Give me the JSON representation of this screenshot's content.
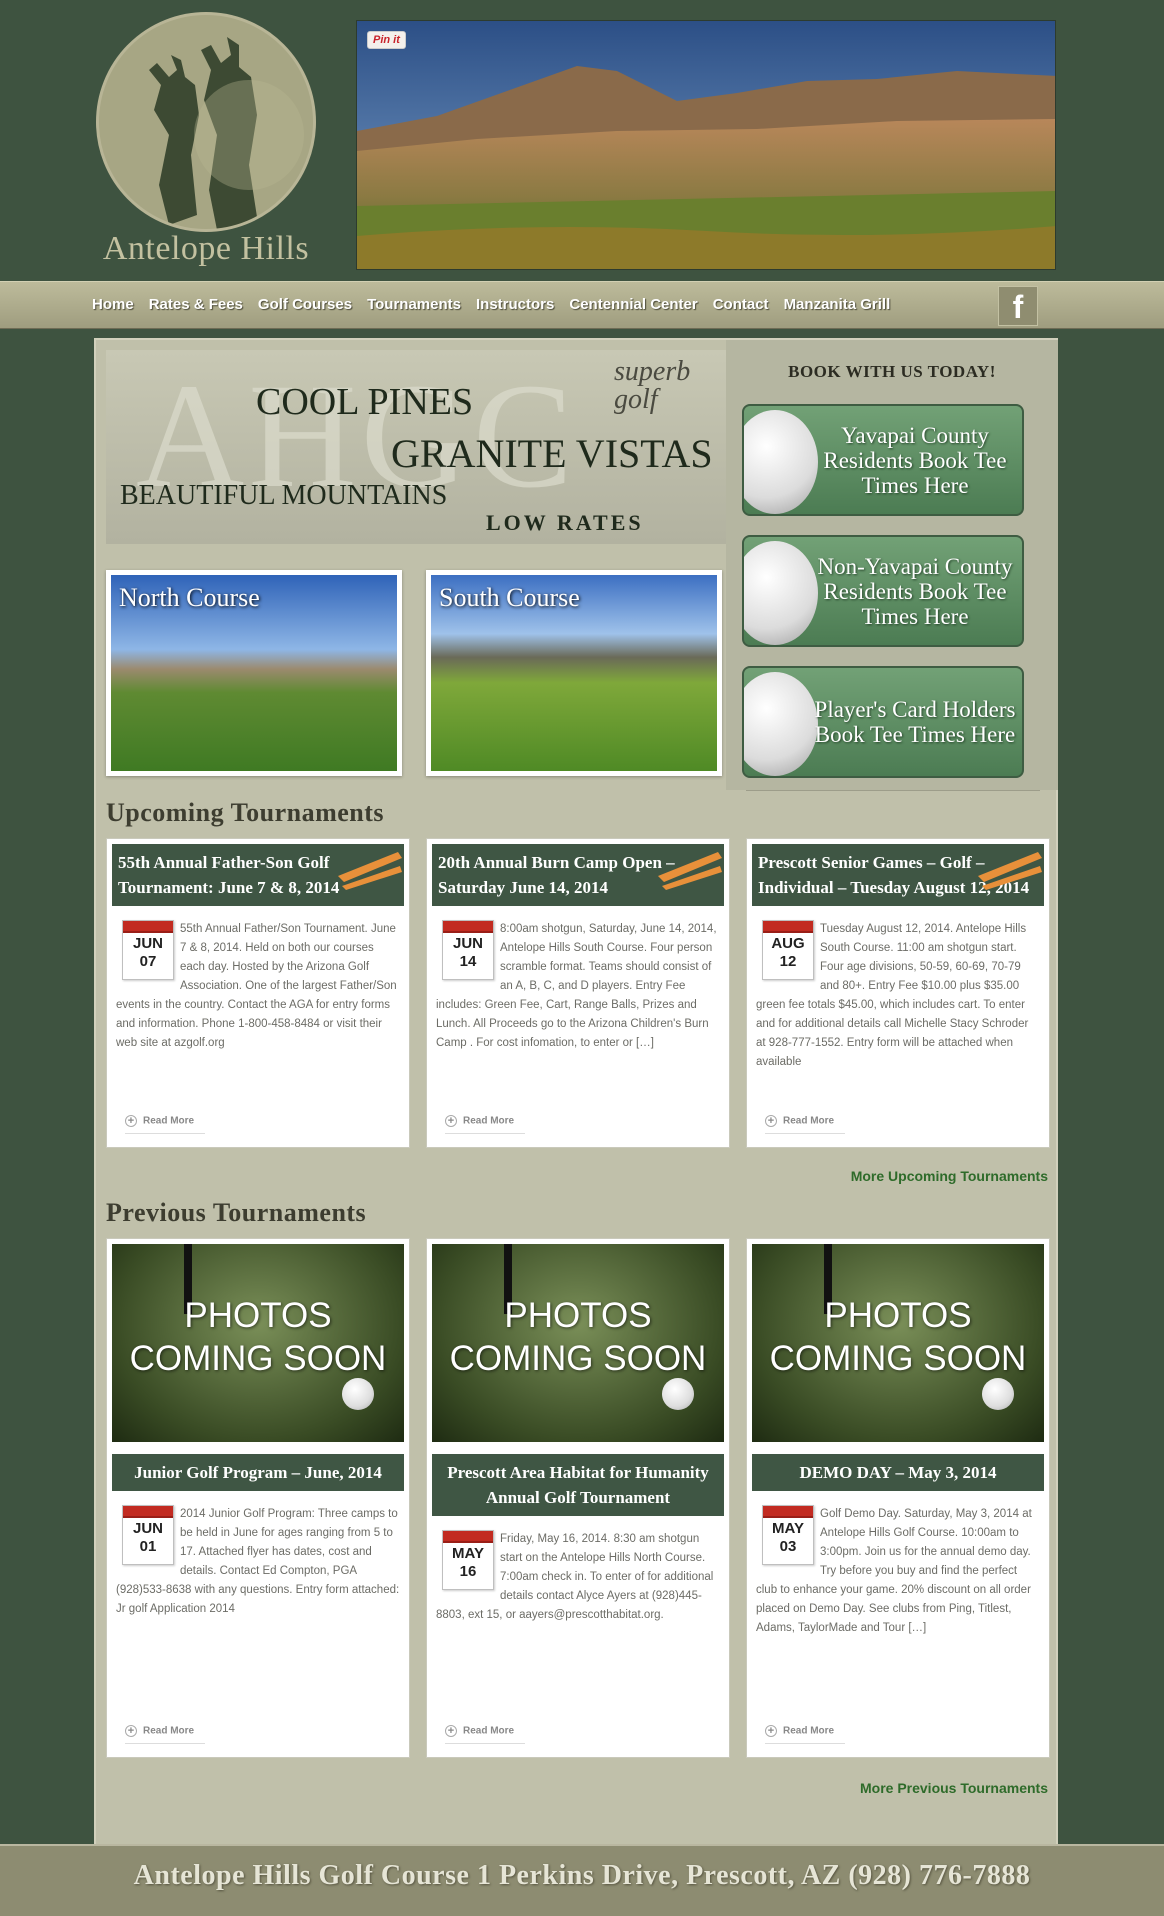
{
  "header": {
    "logo_text": "Antelope Hills",
    "pinit_label": "Pin it"
  },
  "nav": {
    "items": [
      "Home",
      "Rates & Fees",
      "Golf Courses",
      "Tournaments",
      "Instructors",
      "Centennial Center",
      "Contact",
      "Manzanita Grill"
    ],
    "facebook_glyph": "f"
  },
  "banner": {
    "bg_letters": "AHGC",
    "line1": "COOL PINES",
    "line2": "GRANITE VISTAS",
    "line3": "BEAUTIFUL MOUNTAINS",
    "line4": "LOW RATES",
    "tagline": "superb golf"
  },
  "booking": {
    "heading": "BOOK WITH US TODAY!",
    "buttons": [
      "Yavapai County Residents Book Tee Times Here",
      "Non-Yavapai County Residents Book Tee Times Here",
      "Player's Card Holders Book Tee Times Here"
    ]
  },
  "courses": [
    {
      "caption": "North Course"
    },
    {
      "caption": "South Course"
    }
  ],
  "upcoming": {
    "heading": "Upcoming Tournaments",
    "more_link": "More Upcoming Tournaments",
    "cards": [
      {
        "title": "55th Annual Father-Son Golf Tournament: June 7 & 8, 2014",
        "month": "JUN",
        "day": "07",
        "text": "55th Annual Father/Son Tournament. June 7 & 8, 2014. Held on both our courses each day. Hosted by the Arizona Golf Association. One of the largest Father/Son events in the country. Contact the AGA for entry forms and information. Phone 1-800-458-8484 or visit their web site at azgolf.org",
        "read_more": "Read More"
      },
      {
        "title": "20th Annual Burn Camp Open – Saturday June 14, 2014",
        "month": "JUN",
        "day": "14",
        "text": "8:00am shotgun, Saturday, June 14, 2014, Antelope Hills South Course. Four person scramble format. Teams should consist of an A, B, C, and D players. Entry Fee includes: Green Fee, Cart, Range Balls, Prizes and Lunch. All Proceeds go to the Arizona Children's Burn Camp . For cost infomation, to enter or […]",
        "read_more": "Read More"
      },
      {
        "title": "Prescott Senior Games – Golf – Individual – Tuesday August 12, 2014",
        "month": "AUG",
        "day": "12",
        "text": "Tuesday August 12, 2014. Antelope Hills South Course. 11:00 am shotgun start. Four age divisions, 50-59, 60-69, 70-79 and 80+. Entry Fee $10.00 plus $35.00 green fee totals $45.00, which includes cart. To enter and for additional details call Michelle Stacy Schroder at 928-777-1552. Entry form will be attached when available",
        "read_more": "Read More"
      }
    ]
  },
  "previous": {
    "heading": "Previous Tournaments",
    "more_link": "More Previous Tournaments",
    "photo_text_1": "PHOTOS",
    "photo_text_2": "COMING SOON",
    "cards": [
      {
        "title": "Junior Golf Program – June, 2014",
        "month": "JUN",
        "day": "01",
        "text": "2014 Junior Golf Program: Three camps to be held in June for ages ranging from 5 to 17. Attached flyer has dates, cost and details. Contact Ed Compton, PGA (928)533-8638 with any questions. Entry form attached: Jr golf Application 2014",
        "read_more": "Read More"
      },
      {
        "title": "Prescott Area Habitat for Humanity Annual Golf Tournament",
        "month": "MAY",
        "day": "16",
        "text": "Friday, May 16, 2014. 8:30 am shotgun start on the Antelope Hills North Course. 7:00am check in. To enter of for additional details contact Alyce Ayers at (928)445-8803, ext 15, or aayers@prescotthabitat.org.",
        "read_more": "Read More"
      },
      {
        "title": "DEMO DAY – May 3, 2014",
        "month": "MAY",
        "day": "03",
        "text": "Golf Demo Day. Saturday, May 3, 2014 at Antelope Hills Golf Course. 10:00am to 3:00pm. Join us for the annual demo day. Try before you buy and find the perfect club to enhance your game. 20% discount on all order placed on Demo Day. See clubs from Ping, Titlest, Adams, TaylorMade and Tour […]",
        "read_more": "Read More"
      }
    ]
  },
  "footer": {
    "text": "Antelope Hills Golf Course 1 Perkins Drive, Prescott, AZ (928) 776-7888"
  }
}
